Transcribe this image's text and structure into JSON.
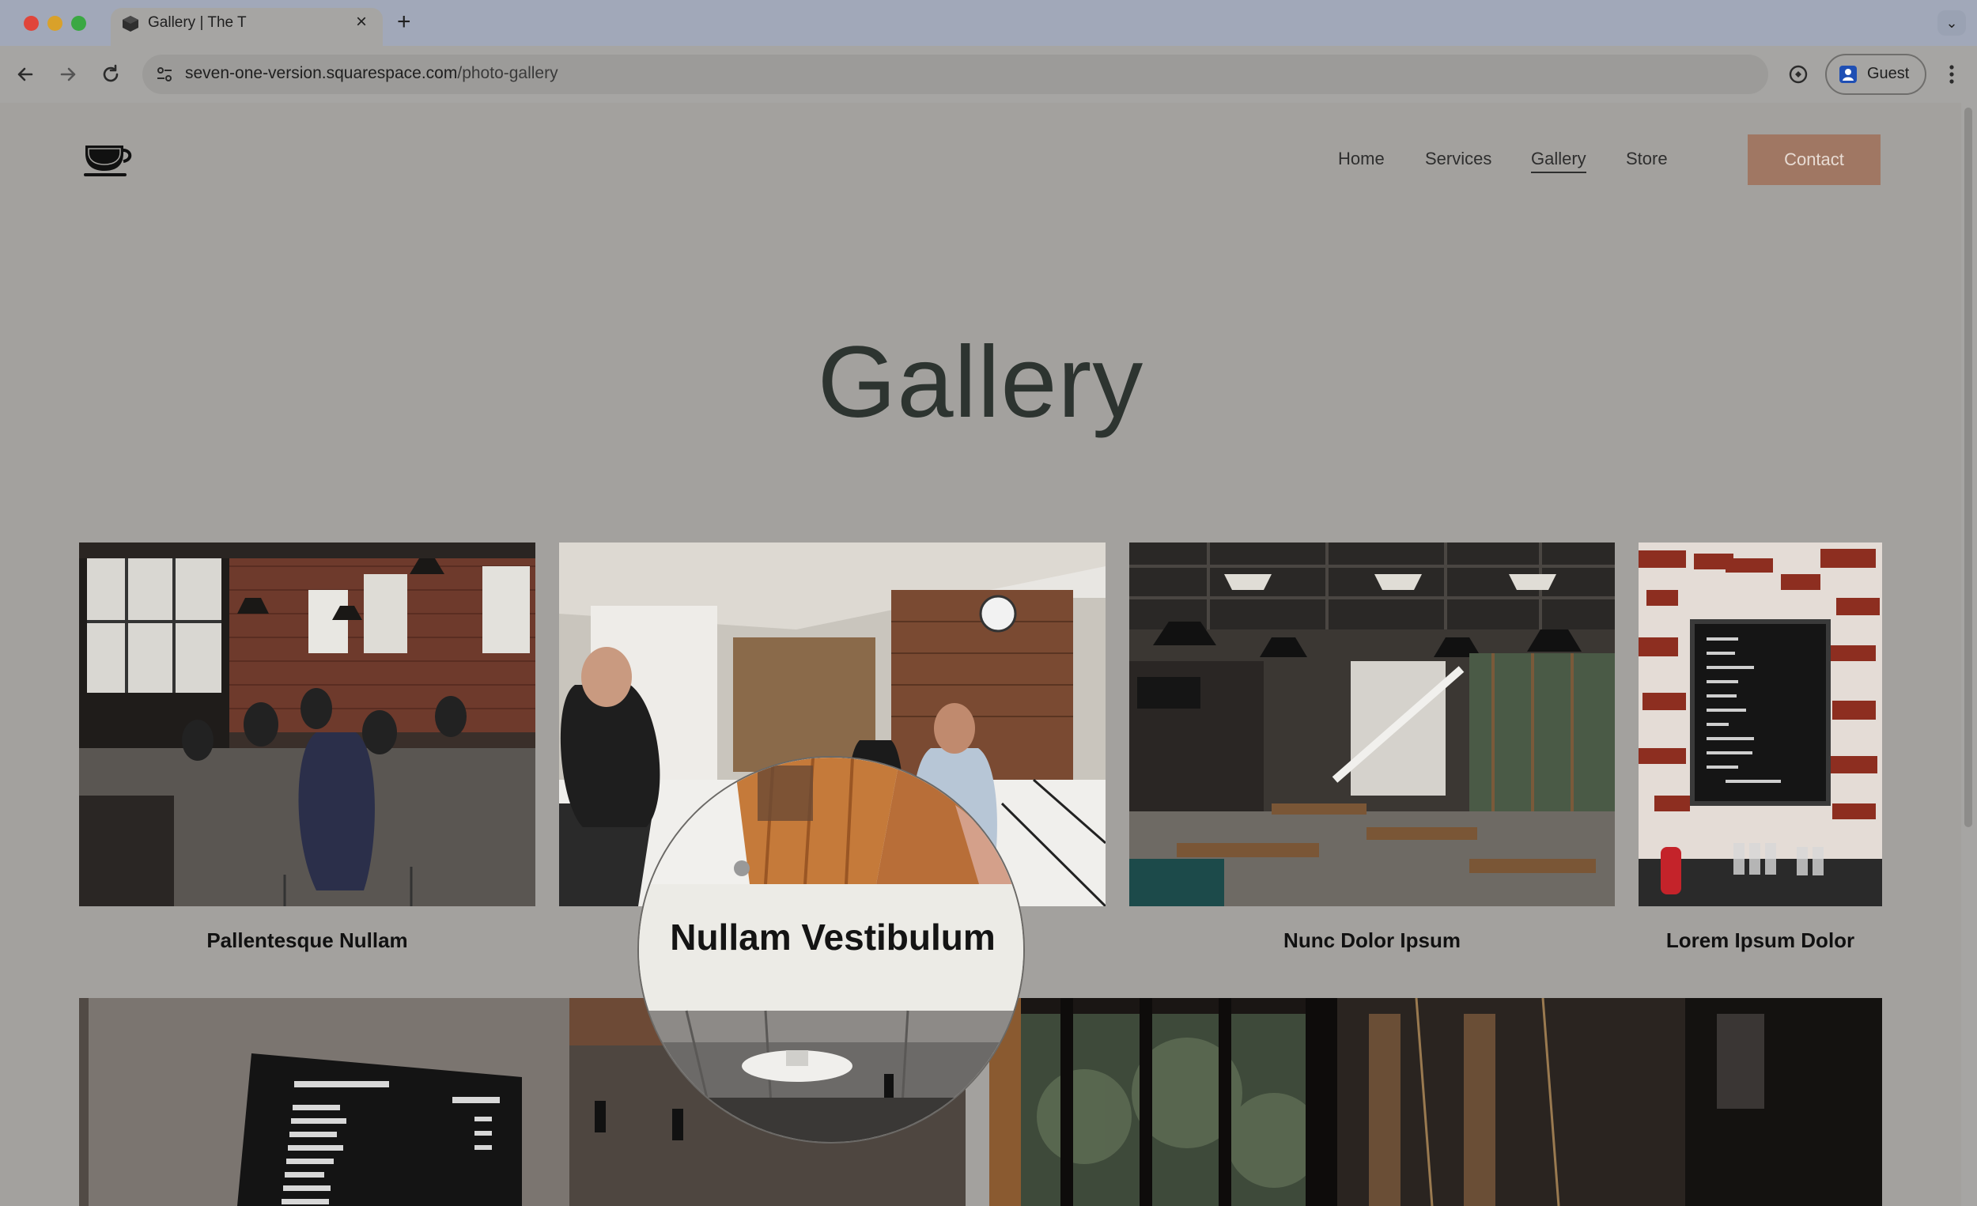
{
  "browser": {
    "tab_title": "Gallery | The T",
    "url_host": "seven-one-version.squarespace.com",
    "url_path": "/photo-gallery",
    "profile_label": "Guest"
  },
  "site": {
    "nav": [
      {
        "label": "Home"
      },
      {
        "label": "Services"
      },
      {
        "label": "Gallery",
        "active": true
      },
      {
        "label": "Store"
      }
    ],
    "contact_label": "Contact",
    "accent": "#a07763",
    "page_title": "Gallery"
  },
  "gallery": {
    "items": [
      {
        "caption": "Pallentesque Nullam"
      },
      {
        "caption": "Nullam Vestibulum"
      },
      {
        "caption": "Nunc Dolor Ipsum"
      },
      {
        "caption": "Lorem Ipsum Dolor"
      }
    ],
    "magnifier_caption": "Nullam Vestibulum"
  }
}
